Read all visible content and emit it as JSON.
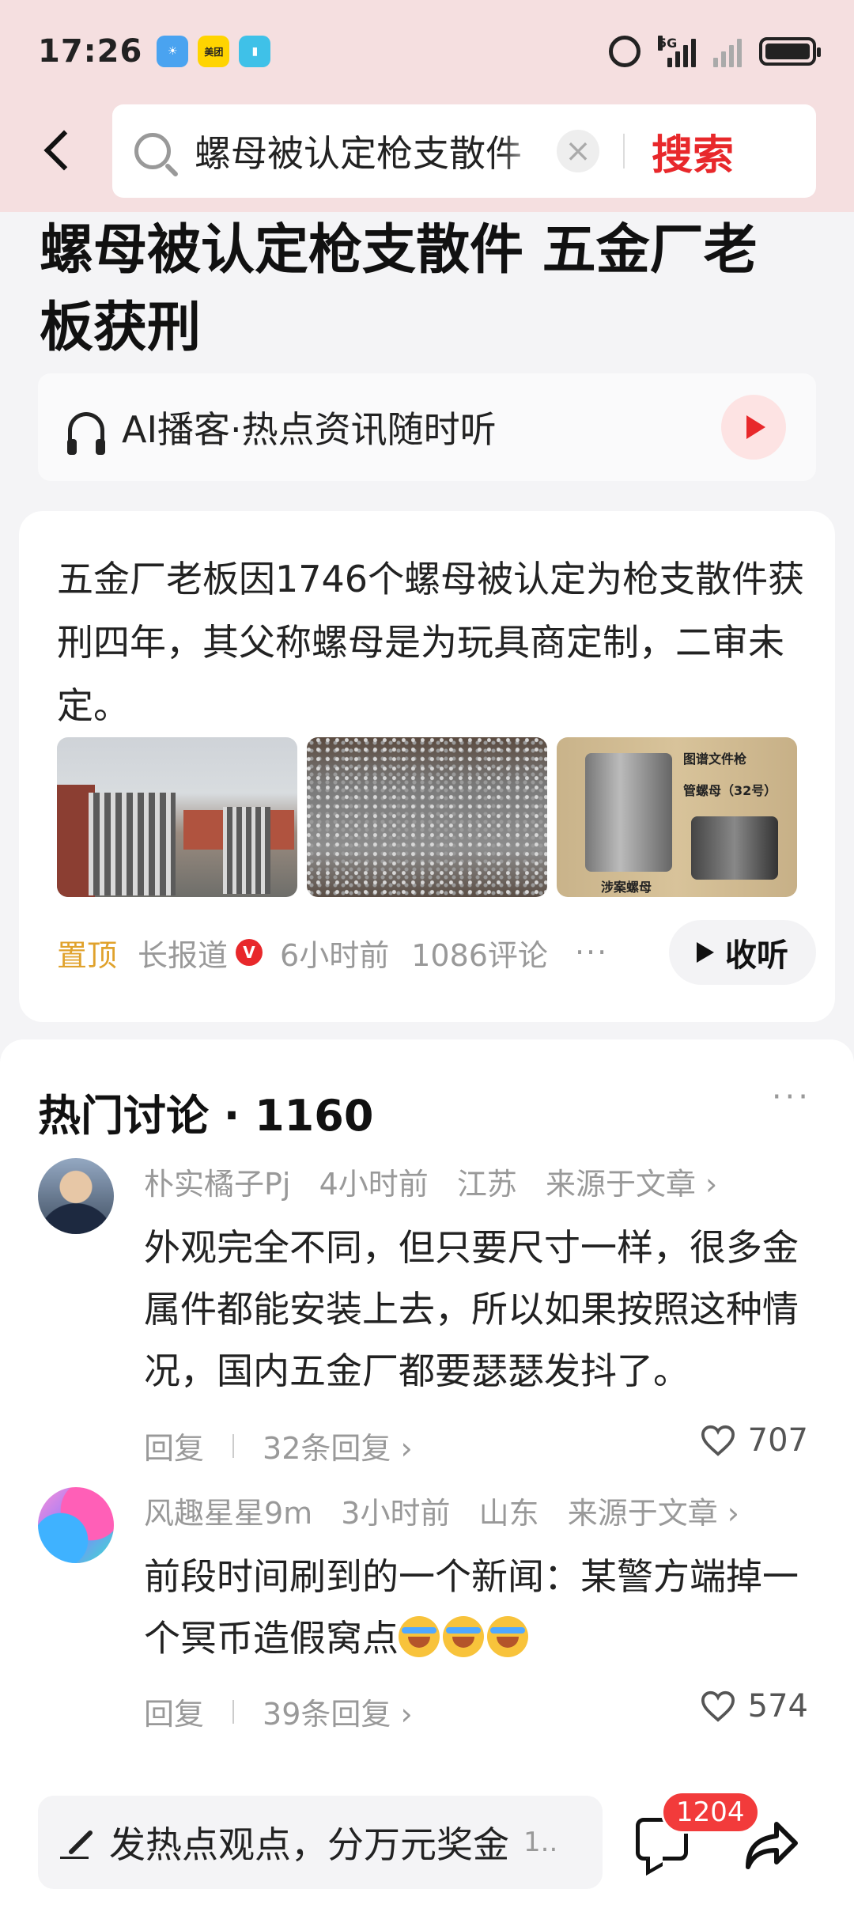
{
  "status_bar": {
    "time": "17:26",
    "network": "5G",
    "app_icons": [
      "weather-icon",
      "meituan-icon",
      "reader-icon"
    ],
    "meituan_label": "美团"
  },
  "search": {
    "query": "螺母被认定枪支散件",
    "button_label": "搜索"
  },
  "article": {
    "headline": "螺母被认定枪支散件 五金厂老板获刑",
    "podcast_label": "AI播客·热点资讯随时听",
    "summary": "五金厂老板因1746个螺母被认定为枪支散件获刑四年，其父称螺母是为玩具商定制，二审未定。",
    "thumb3_caption_top": "图谱文件枪",
    "thumb3_caption_mid": "管螺母（32号）",
    "thumb3_caption_bottom": "涉案螺母",
    "pinned_label": "置顶",
    "source": "长报道",
    "verified_badge": "V",
    "time": "6小时前",
    "comments": "1086评论",
    "more": "···",
    "listen_label": "收听"
  },
  "discussion": {
    "title": "热门讨论 · 1160",
    "more": "···",
    "comments": [
      {
        "user": "朴实橘子Pj",
        "time": "4小时前",
        "location": "江苏",
        "source": "来源于文章 ›",
        "text": "外观完全不同，但只要尺寸一样，很多金属件都能安装上去，所以如果按照这种情况，国内五金厂都要瑟瑟发抖了。",
        "reply_label": "回复",
        "replies": "32条回复 ›",
        "likes": "707"
      },
      {
        "user": "风趣星星9m",
        "time": "3小时前",
        "location": "山东",
        "source": "来源于文章 ›",
        "text": "前段时间刷到的一个新闻：某警方端掉一个冥币造假窝点",
        "reply_label": "回复",
        "replies": "39条回复 ›",
        "likes": "574"
      }
    ]
  },
  "bottom_bar": {
    "post_placeholder": "发热点观点，分万元奖金",
    "post_more": "1..",
    "comment_count": "1204"
  },
  "colors": {
    "accent": "#e8282b",
    "pin": "#e0a22c",
    "header_bg": "#f5dfe0"
  }
}
